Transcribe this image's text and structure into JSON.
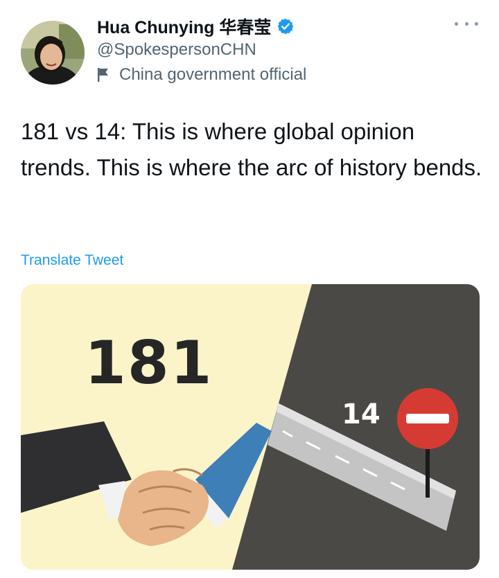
{
  "author": {
    "display_name": "Hua Chunying 华春莹",
    "handle": "@SpokespersonCHN",
    "label": "China government official"
  },
  "tweet": {
    "text": "181 vs 14: This is where global opinion trends. This is where the arc of history bends.",
    "translate_link": "Translate Tweet"
  },
  "image": {
    "big_number": "181",
    "small_number": "14"
  },
  "icons": {
    "verified": "verified-badge-icon",
    "label": "flag-icon",
    "more": "more-options-icon",
    "no_entry": "no-entry-sign-icon",
    "handshake": "handshake-icon"
  },
  "colors": {
    "accent": "#1d9bf0",
    "secondary_text": "#536471",
    "image_left_bg": "#fbf4c8",
    "image_right_bg": "#4b4945",
    "sign_red": "#d63b33"
  }
}
